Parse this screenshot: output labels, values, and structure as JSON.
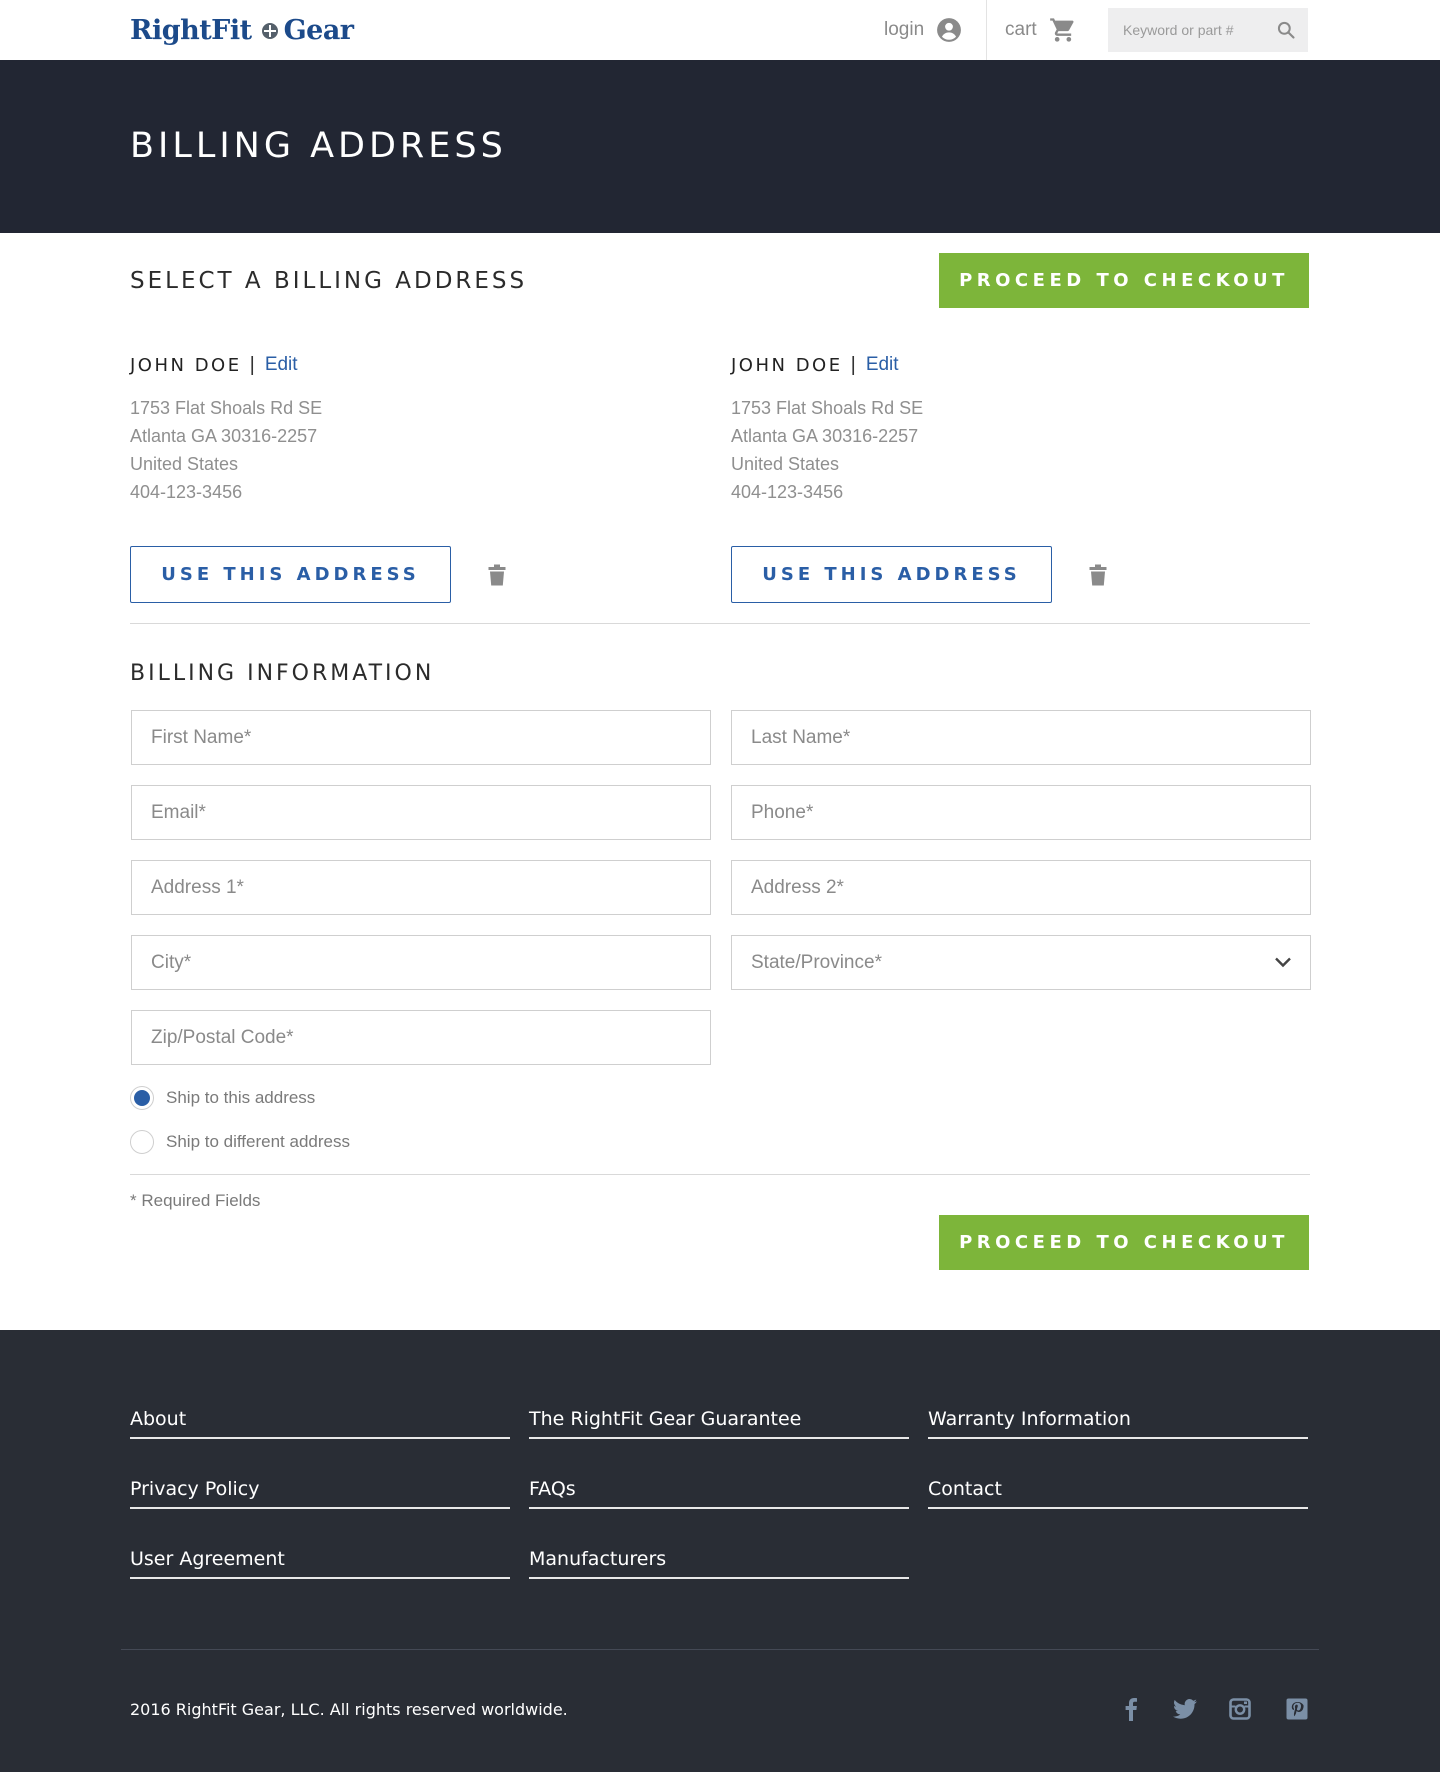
{
  "header": {
    "logo_left": "RightFit",
    "logo_right": "Gear",
    "login_label": "login",
    "cart_label": "cart",
    "search_placeholder": "Keyword or part #"
  },
  "hero": {
    "title": "BILLING ADDRESS"
  },
  "select_section": {
    "title": "SELECT A BILLING ADDRESS",
    "checkout_label": "PROCEED TO CHECKOUT"
  },
  "addresses": [
    {
      "name": "JOHN DOE",
      "separator": "|",
      "edit_label": "Edit",
      "lines": [
        "1753 Flat Shoals Rd SE",
        "Atlanta GA 30316-2257",
        "United States",
        "404-123-3456"
      ],
      "use_label": "USE THIS ADDRESS"
    },
    {
      "name": "JOHN DOE",
      "separator": "|",
      "edit_label": "Edit",
      "lines": [
        "1753 Flat Shoals Rd SE",
        "Atlanta GA 30316-2257",
        "United States",
        "404-123-3456"
      ],
      "use_label": "USE THIS ADDRESS"
    }
  ],
  "billing_form": {
    "title": "BILLING INFORMATION",
    "first_name_placeholder": "First Name*",
    "last_name_placeholder": "Last Name*",
    "email_placeholder": "Email*",
    "phone_placeholder": "Phone*",
    "address1_placeholder": "Address 1*",
    "address2_placeholder": "Address 2*",
    "city_placeholder": "City*",
    "state_label": "State/Province*",
    "zip_placeholder": "Zip/Postal Code*",
    "ship_same_label": "Ship to this address",
    "ship_different_label": "Ship to different address",
    "required_note": "* Required Fields",
    "checkout_label": "PROCEED TO CHECKOUT"
  },
  "footer": {
    "links": {
      "about": "About",
      "guarantee": "The RightFit Gear Guarantee",
      "warranty": "Warranty Information",
      "privacy": "Privacy Policy",
      "faqs": "FAQs",
      "contact": "Contact",
      "user_agreement": "User Agreement",
      "manufacturers": "Manufacturers"
    },
    "copyright": "2016 RightFit Gear, LLC. All rights reserved worldwide.",
    "social_icons": [
      "facebook-icon",
      "twitter-icon",
      "instagram-icon",
      "pinterest-icon"
    ]
  },
  "colors": {
    "brand_blue": "#1c4a8a",
    "link_blue": "#2a5ea6",
    "accent_green": "#7db53a",
    "hero_bg": "#222633",
    "footer_bg": "#292d35"
  }
}
